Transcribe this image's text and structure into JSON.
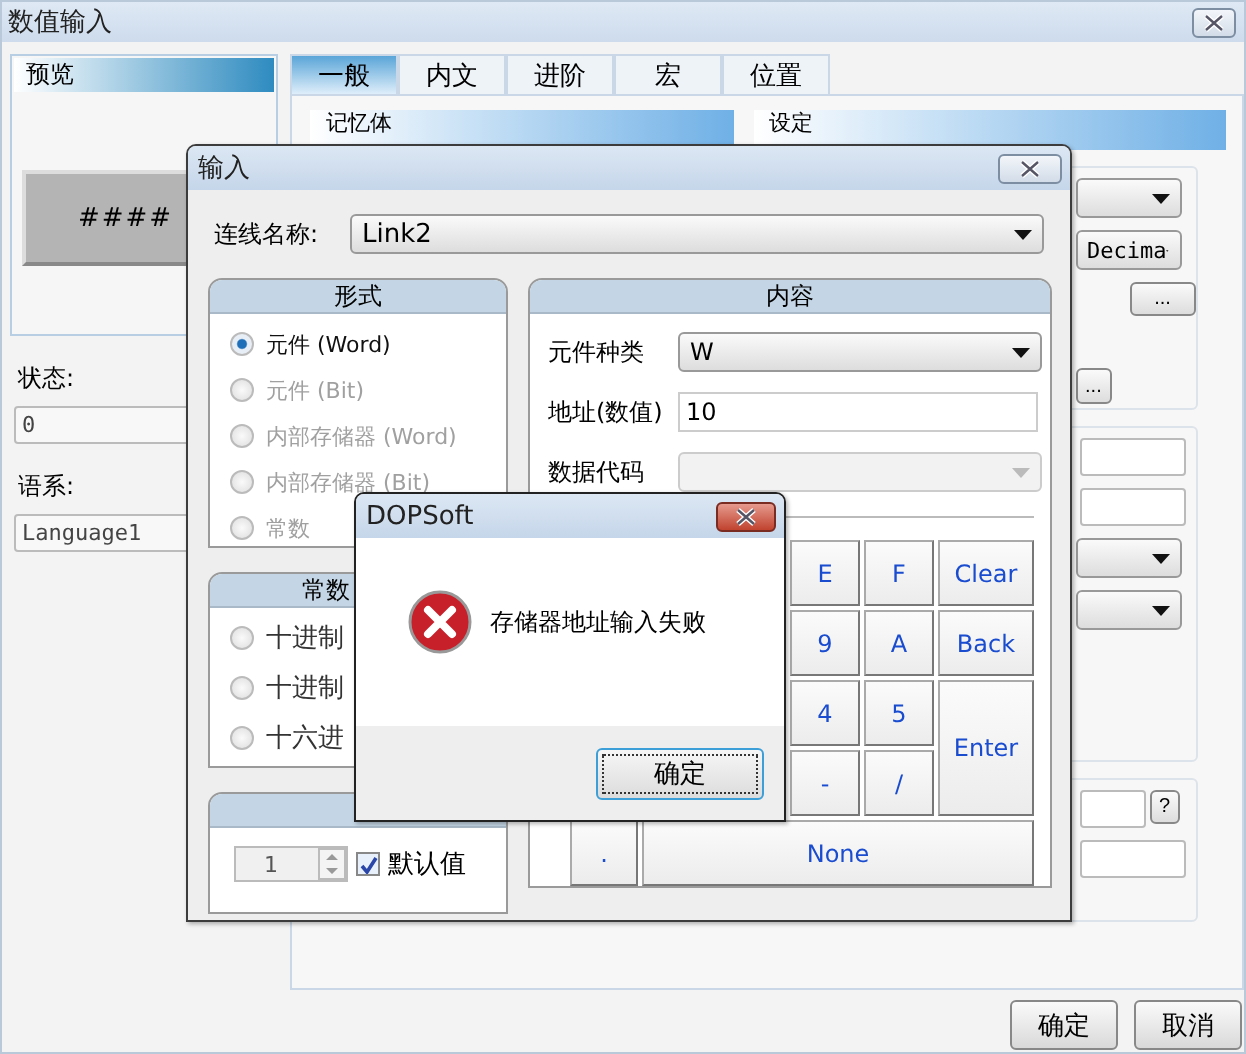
{
  "window": {
    "title": "数值输入"
  },
  "preview": {
    "title": "预览",
    "text": "####"
  },
  "status": {
    "label": "状态:",
    "value": "0"
  },
  "language": {
    "label": "语系:",
    "value": "Language1"
  },
  "tabs": [
    {
      "label": "一般",
      "selected": true
    },
    {
      "label": "内文",
      "selected": false
    },
    {
      "label": "进阶",
      "selected": false
    },
    {
      "label": "宏",
      "selected": false
    },
    {
      "label": "位置",
      "selected": false
    }
  ],
  "memory_section": {
    "title": "记忆体"
  },
  "settings_section": {
    "title": "设定",
    "groups": [
      [
        {
          "kind": "dropdown"
        },
        {
          "kind": "dropdown",
          "value": "Decima"
        },
        {
          "kind": "small_button",
          "label": "..."
        },
        {
          "kind": "button",
          "label": "..."
        }
      ],
      [
        {
          "kind": "field"
        },
        {
          "kind": "field"
        },
        {
          "kind": "dropdown"
        },
        {
          "kind": "dropdown"
        }
      ],
      [
        {
          "kind": "help_field",
          "label": "?"
        },
        {
          "kind": "field"
        }
      ]
    ]
  },
  "buttons": [
    "确定",
    "取消"
  ],
  "input_dialog": {
    "title": "输入",
    "link": {
      "label": "连线名称:",
      "value": "Link2"
    },
    "format_group": {
      "title": "形式",
      "options": [
        {
          "label": "元件 (Word)",
          "selected": true,
          "disabled": false
        },
        {
          "label": "元件 (Bit)",
          "selected": false,
          "disabled": true
        },
        {
          "label": "内部存储器 (Word)",
          "selected": false,
          "disabled": true
        },
        {
          "label": "内部存储器 (Bit)",
          "selected": false,
          "disabled": true
        },
        {
          "label": "常数",
          "selected": false,
          "disabled": true
        }
      ]
    },
    "constant_group": {
      "title": "常数",
      "options": [
        {
          "label": "十进制",
          "selected": false
        },
        {
          "label": "十进制",
          "selected": false
        },
        {
          "label": "十六进",
          "selected": false
        }
      ]
    },
    "station_group": {
      "spinner": "1",
      "default": {
        "label": "默认值",
        "checked": true
      }
    },
    "content_group": {
      "title": "内容",
      "device_type": {
        "label": "元件种类",
        "value": "W"
      },
      "address": {
        "label": "地址(数值)",
        "value": "10"
      },
      "data_code": {
        "label": "数据代码",
        "disabled": true
      },
      "key_rows": [
        [
          "E",
          "F",
          "Clear"
        ],
        [
          "9",
          "A",
          "Back"
        ],
        [
          "4",
          "5",
          "Enter"
        ],
        [
          "-",
          "/"
        ],
        [
          ".",
          "None"
        ]
      ]
    }
  },
  "alert": {
    "title": "DOPSoft",
    "message": "存储器地址输入失败",
    "button": "确定"
  }
}
